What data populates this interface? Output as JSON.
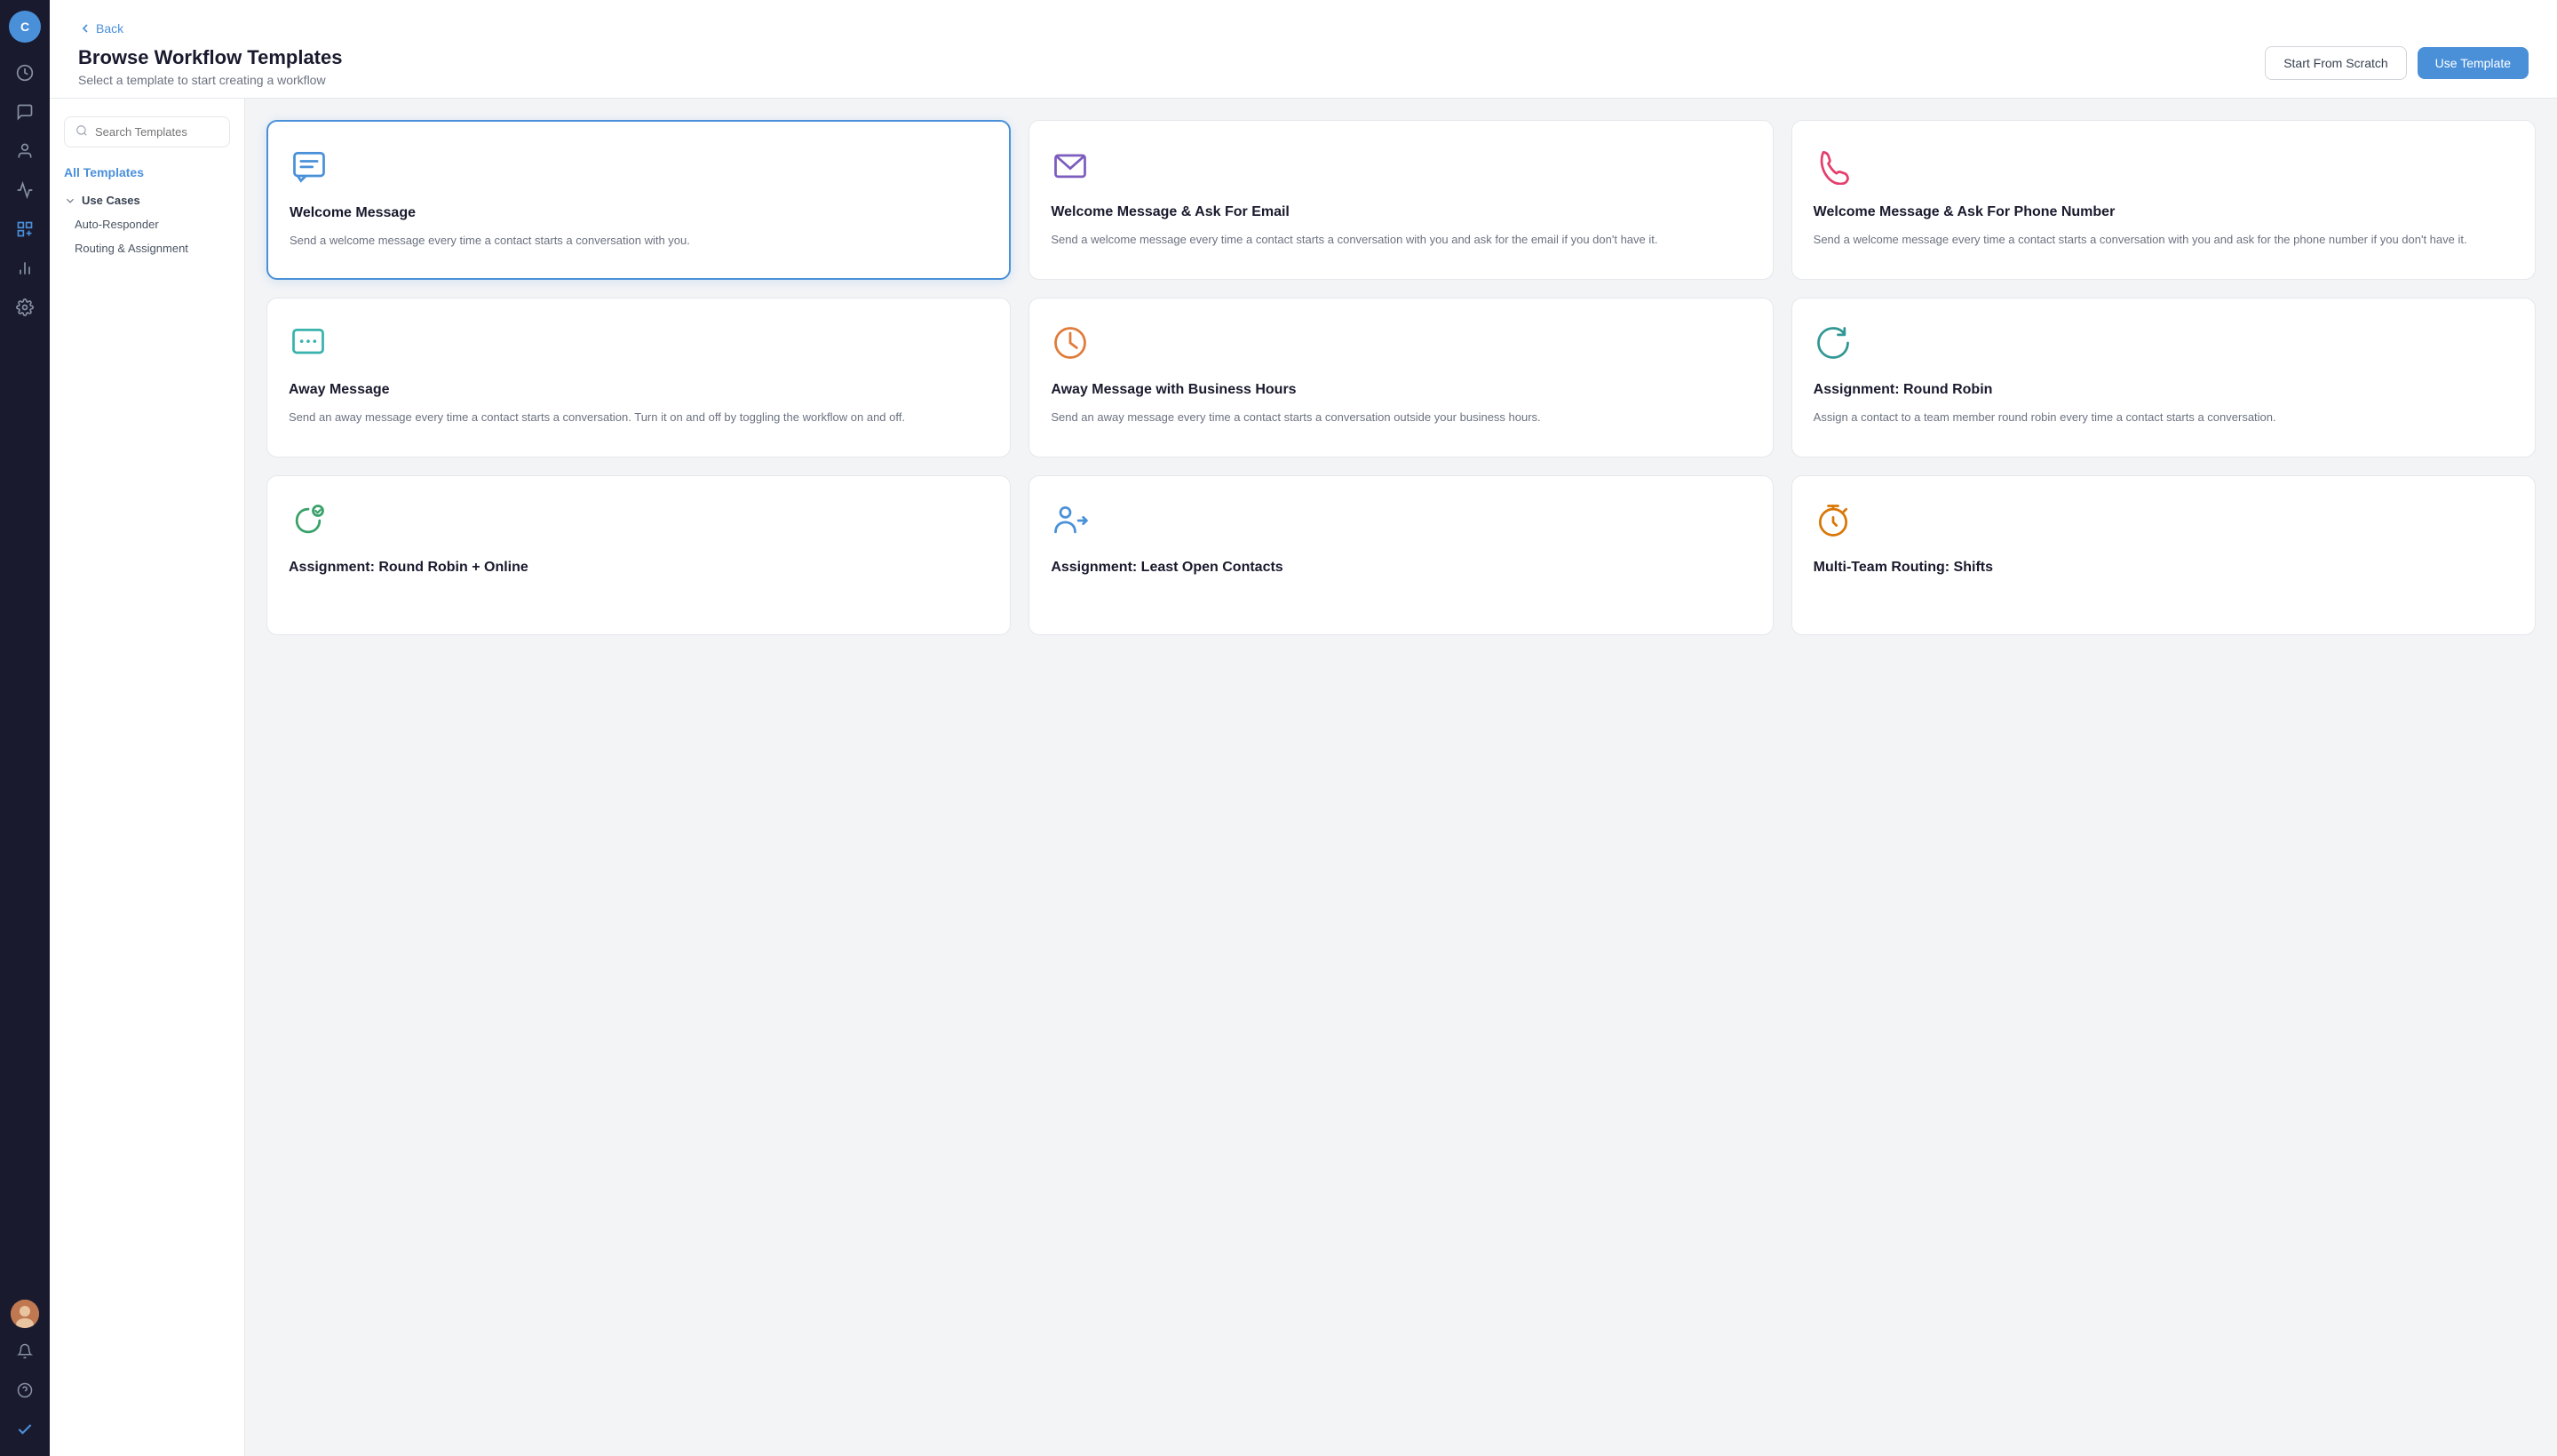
{
  "nav": {
    "avatar_letter": "C",
    "items": [
      {
        "name": "dashboard-icon",
        "label": "Dashboard"
      },
      {
        "name": "conversations-icon",
        "label": "Conversations"
      },
      {
        "name": "contacts-icon",
        "label": "Contacts"
      },
      {
        "name": "campaigns-icon",
        "label": "Campaigns"
      },
      {
        "name": "workflows-icon",
        "label": "Workflows"
      },
      {
        "name": "reports-icon",
        "label": "Reports"
      },
      {
        "name": "settings-icon",
        "label": "Settings"
      }
    ],
    "bottom_items": [
      {
        "name": "notifications-icon",
        "label": "Notifications"
      },
      {
        "name": "help-icon",
        "label": "Help"
      },
      {
        "name": "checkmark-icon",
        "label": "Status"
      }
    ]
  },
  "header": {
    "back_label": "Back",
    "title": "Browse Workflow Templates",
    "subtitle": "Select a template to start creating a workflow",
    "start_from_scratch_label": "Start From Scratch",
    "use_template_label": "Use Template"
  },
  "sidebar": {
    "search_placeholder": "Search Templates",
    "all_templates_label": "All Templates",
    "use_cases_label": "Use Cases",
    "items": [
      {
        "label": "Auto-Responder"
      },
      {
        "label": "Routing & Assignment"
      }
    ]
  },
  "templates": [
    {
      "id": "welcome-message",
      "title": "Welcome Message",
      "description": "Send a welcome message every time a contact starts a conversation with you.",
      "icon_type": "chat",
      "icon_color": "#4a90d9",
      "selected": true
    },
    {
      "id": "welcome-email",
      "title": "Welcome Message & Ask For Email",
      "description": "Send a welcome message every time a contact starts a conversation with you and ask for the email if you don't have it.",
      "icon_type": "email",
      "icon_color": "#7c5cbf",
      "selected": false
    },
    {
      "id": "welcome-phone",
      "title": "Welcome Message & Ask For Phone Number",
      "description": "Send a welcome message every time a contact starts a conversation with you and ask for the phone number if you don't have it.",
      "icon_type": "phone",
      "icon_color": "#e53e6d",
      "selected": false
    },
    {
      "id": "away-message",
      "title": "Away Message",
      "description": "Send an away message every time a contact starts a conversation. Turn it on and off by toggling the workflow on and off.",
      "icon_type": "chat-away",
      "icon_color": "#38b2ac",
      "selected": false
    },
    {
      "id": "away-business-hours",
      "title": "Away Message with Business Hours",
      "description": "Send an away message every time a contact starts a conversation outside your business hours.",
      "icon_type": "clock",
      "icon_color": "#e07b39",
      "selected": false
    },
    {
      "id": "round-robin",
      "title": "Assignment: Round Robin",
      "description": "Assign a contact to a team member round robin every time a contact starts a conversation.",
      "icon_type": "refresh",
      "icon_color": "#319795",
      "selected": false
    },
    {
      "id": "round-robin-online",
      "title": "Assignment: Round Robin + Online",
      "description": "",
      "icon_type": "round-robin-check",
      "icon_color": "#38a169",
      "selected": false
    },
    {
      "id": "least-open",
      "title": "Assignment: Least Open Contacts",
      "description": "",
      "icon_type": "person-arrow",
      "icon_color": "#4a90d9",
      "selected": false
    },
    {
      "id": "multi-team",
      "title": "Multi-Team Routing: Shifts",
      "description": "",
      "icon_type": "timer",
      "icon_color": "#d97706",
      "selected": false
    }
  ]
}
